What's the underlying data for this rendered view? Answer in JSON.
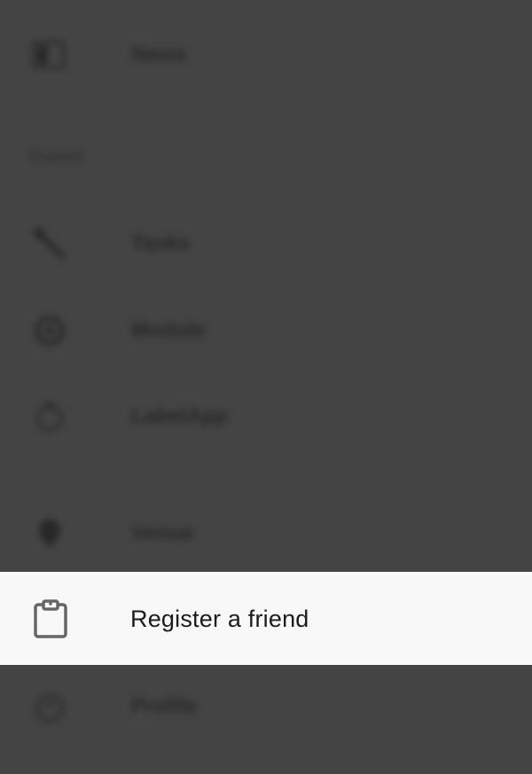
{
  "menu": {
    "background_items": [
      {
        "label": "News",
        "icon": "news-icon"
      },
      {
        "label": "Tasks",
        "icon": "wrench-icon"
      },
      {
        "label": "Module",
        "icon": "gear-icon"
      },
      {
        "label": "LabelApp",
        "icon": "timer-icon"
      },
      {
        "label": "Venue",
        "icon": "pin-icon"
      },
      {
        "label": "Profile",
        "icon": "clock-icon"
      }
    ],
    "section_title": "Events",
    "active_item": {
      "label": "Register a friend",
      "icon": "clipboard-icon"
    }
  },
  "colors": {
    "overlay": "#444444",
    "active_background": "#f8f8f8",
    "active_text": "#1c1c1c",
    "icon": "#666666"
  }
}
